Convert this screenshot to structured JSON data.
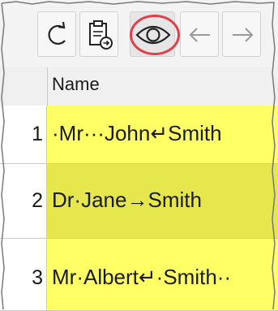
{
  "toolbar": {
    "buttons": [
      {
        "name": "refresh-button",
        "icon": "refresh-icon"
      },
      {
        "name": "paste-button",
        "icon": "clipboard-paste-icon"
      },
      {
        "name": "show-whitespace-button",
        "icon": "eye-icon"
      },
      {
        "name": "back-button",
        "icon": "arrow-left-icon"
      },
      {
        "name": "forward-button",
        "icon": "arrow-right-icon"
      }
    ]
  },
  "table": {
    "header": "Name",
    "rows": [
      {
        "num": "1",
        "value": "·Mr···John↵Smith"
      },
      {
        "num": "2",
        "value": "Dr·Jane→Smith"
      },
      {
        "num": "3",
        "value": "Mr·Albert↵·Smith··"
      }
    ]
  },
  "colors": {
    "cell_yellow": "#ffff66",
    "cell_yellow_selected": "#e6e64d",
    "highlight_ring": "#e0404a"
  }
}
